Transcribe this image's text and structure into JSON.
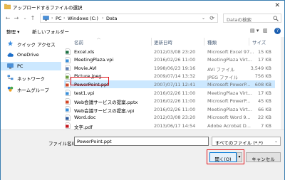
{
  "window": {
    "title": "アップロードするファイルの選択",
    "close_glyph": "✕"
  },
  "nav": {
    "back": "←",
    "forward": "→",
    "up_dropdown": "⌄",
    "up": "↑"
  },
  "address": {
    "segments": [
      "PC",
      "Windows (C:)",
      "Data"
    ],
    "separator": "›",
    "dropdown": "⌄",
    "refresh": "⟳"
  },
  "search": {
    "placeholder": "Dataの検索"
  },
  "toolbar": {
    "organize": "整理 ▾",
    "new_folder": "新しいフォルダー",
    "view_toggle": "▤ ▾",
    "pane_toggle": "▥",
    "help": "?"
  },
  "sidebar": {
    "items": [
      {
        "label": "クイック アクセス",
        "icon": "star-icon",
        "selected": false
      },
      {
        "label": "OneDrive",
        "icon": "cloud-icon",
        "selected": false
      },
      {
        "label": "PC",
        "icon": "computer-icon",
        "selected": true
      },
      {
        "label": "ネットワーク",
        "icon": "network-icon",
        "selected": false
      },
      {
        "label": "ホームグループ",
        "icon": "homegroup-icon",
        "selected": false
      }
    ]
  },
  "columns": {
    "name": "名前",
    "date": "更新日時",
    "type": "種類",
    "size": "サイズ"
  },
  "files": [
    {
      "name": "Excel.xls",
      "date": "2012/03/08 23:20",
      "type": "Microsoft Excel 97...",
      "size": "15 KB",
      "icon": "excel-file-icon",
      "color": "#1f7244",
      "selected": false
    },
    {
      "name": "MeetingPlaza.vpi",
      "date": "2016/02/26 11:00",
      "type": "MeetingPlaza Virt...",
      "size": "17 KB",
      "icon": "vpi-file-icon",
      "color": "#3a8fd9",
      "selected": false
    },
    {
      "name": "Movie.AVI",
      "date": "1998/06/23 19:16",
      "type": "AVI ファイル",
      "size": "3,549 KB",
      "icon": "video-file-icon",
      "color": "#5b7db1",
      "selected": false
    },
    {
      "name": "Picture.jpeg",
      "date": "2009/07/14 13:32",
      "type": "JPEG ファイル",
      "size": "756 KB",
      "icon": "image-file-icon",
      "color": "#6b9e3f",
      "selected": false
    },
    {
      "name": "PowerPoint.ppt",
      "date": "2007/07/11 12:41",
      "type": "Microsoft PowerP...",
      "size": "608 KB",
      "icon": "powerpoint-file-icon",
      "color": "#d24726",
      "selected": true
    },
    {
      "name": "test1.vpi",
      "date": "2016/02/26 11:00",
      "type": "MeetingPlaza Virt...",
      "size": "17 KB",
      "icon": "vpi-file-icon",
      "color": "#3a8fd9",
      "selected": false
    },
    {
      "name": "Web会議サービスの提案.pptx",
      "date": "2016/02/26 11:00",
      "type": "Microsoft PowerP...",
      "size": "45 KB",
      "icon": "powerpoint-file-icon",
      "color": "#d24726",
      "selected": false
    },
    {
      "name": "Web会議サービスの提案.vpi",
      "date": "2016/02/26 11:00",
      "type": "MeetingPlaza Virt...",
      "size": "66 KB",
      "icon": "vpi-file-icon",
      "color": "#3a8fd9",
      "selected": false
    },
    {
      "name": "Word.doc",
      "date": "2012/03/08 23:20",
      "type": "Microsoft Word 9...",
      "size": "22 KB",
      "icon": "word-file-icon",
      "color": "#2b579a",
      "selected": false
    },
    {
      "name": "文字.pdf",
      "date": "2013/06/17 14:54",
      "type": "Adobe Acrobat D...",
      "size": "7 KB",
      "icon": "pdf-file-icon",
      "color": "#c4161c",
      "selected": false
    }
  ],
  "footer": {
    "filename_label": "ファイル名(N):",
    "filename_value": "PowerPoint.ppt",
    "filter_value": "すべてのファイル (*.*)",
    "dropdown": "⌄",
    "open_label": "開く(O)",
    "open_dropdown": "▾",
    "cancel_label": "キャンセル"
  },
  "colors": {
    "accent": "#0078d7",
    "selection": "#cce8ff",
    "highlight": "#e0131a"
  }
}
